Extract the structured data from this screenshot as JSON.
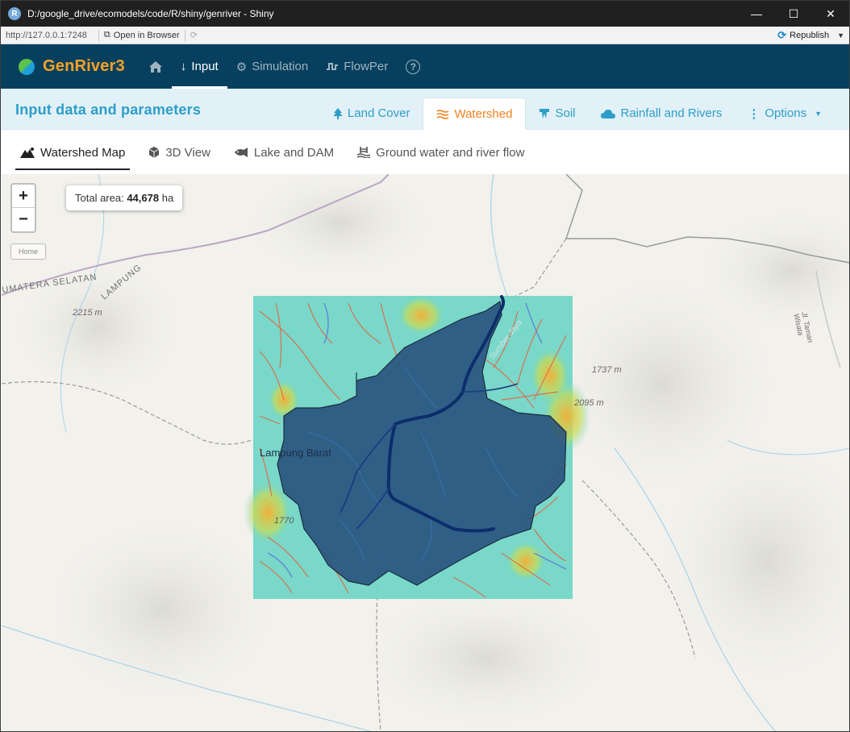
{
  "window": {
    "title": "D:/google_drive/ecomodels/code/R/shiny/genriver - Shiny",
    "app_icon_letter": "R",
    "minimize": "—",
    "maximize": "☐",
    "close": "✕"
  },
  "addressbar": {
    "url": "http://127.0.0.1:7248",
    "open_in_browser": "Open in Browser",
    "republish": "Republish"
  },
  "navbar": {
    "brand_name": "GenRiver",
    "brand_version": "3",
    "items": [
      {
        "label": "",
        "icon": "home-icon"
      },
      {
        "label": "Input",
        "icon": "arrow-down-icon",
        "active": true
      },
      {
        "label": "Simulation",
        "icon": "gears-icon"
      },
      {
        "label": "FlowPer",
        "icon": "wave-icon"
      },
      {
        "label": "",
        "icon": "help-icon"
      }
    ]
  },
  "header": {
    "title": "Input data and parameters",
    "tabs": [
      {
        "label": "Land Cover",
        "icon": "tree-icon"
      },
      {
        "label": "Watershed",
        "icon": "water-icon",
        "active": true
      },
      {
        "label": "Soil",
        "icon": "soil-icon"
      },
      {
        "label": "Rainfall and Rivers",
        "icon": "cloud-icon"
      },
      {
        "label": "Options",
        "icon": "kebab-icon"
      }
    ]
  },
  "subtabs": [
    {
      "label": "Watershed Map",
      "icon": "mountain-icon",
      "active": true
    },
    {
      "label": "3D View",
      "icon": "cube-icon"
    },
    {
      "label": "Lake and DAM",
      "icon": "fish-icon"
    },
    {
      "label": "Ground water and river flow",
      "icon": "water-ladder-icon"
    }
  ],
  "map": {
    "zoom_in": "+",
    "zoom_out": "−",
    "home": "Home",
    "total_area_label": "Total area:",
    "total_area_value": "44,678",
    "total_area_unit": "ha",
    "labels": {
      "region_left": "UMATERA SELATAN",
      "region_lampung": "LAMPUNG",
      "elev_1": "2215 m",
      "elev_2": "1737 m",
      "elev_3": "2095 m",
      "elev_4": "1770",
      "place_1": "Lampung Barat",
      "place_2": "Sumber Jaya",
      "road_1": "Jl. Taman Wisata"
    },
    "colors": {
      "watershed_fill": "#234a7a",
      "raster_base": "#6fd6c6",
      "river": "#e8603c"
    }
  }
}
